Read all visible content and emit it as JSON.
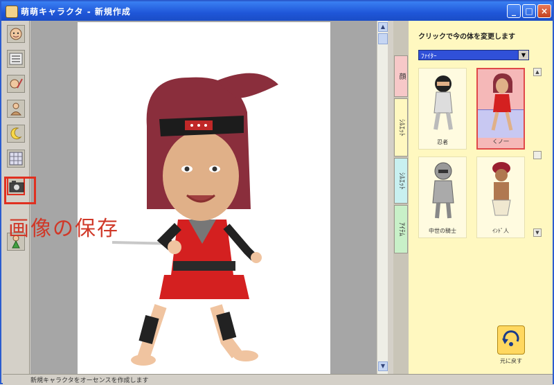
{
  "window": {
    "title": "萌萌キャラクタ - 新規作成",
    "minimize_label": "_",
    "maximize_label": "□",
    "close_label": "×"
  },
  "toolbar": {
    "tools": [
      {
        "icon": "face-icon"
      },
      {
        "icon": "list-icon"
      },
      {
        "icon": "edit-icon"
      },
      {
        "icon": "person-icon"
      },
      {
        "icon": "moon-icon"
      },
      {
        "icon": "grid-icon"
      },
      {
        "icon": "save-image-icon",
        "selected": true
      },
      {
        "icon": "character-icon"
      }
    ]
  },
  "canvas": {
    "overlay_caption": "画像の保存"
  },
  "panel": {
    "tabs": [
      "顔",
      "ｼﾙｴｯﾄ",
      "ｼﾙｴｯﾄ",
      "ｱｲﾃﾑ"
    ],
    "instruction": "クリックで今の体を変更します",
    "category_select": "ﾌｧｲﾀｰ",
    "items": [
      {
        "label": "忍者"
      },
      {
        "label": "くノ一",
        "selected": true
      },
      {
        "label": "中世の騎士"
      },
      {
        "label": "ｲﾝﾄﾞ人"
      }
    ],
    "undo_label": "元に戻す"
  },
  "status": {
    "message": "新規キャラクタをオーセンスを作成します"
  },
  "colors": {
    "titlebar": "#1f56d8",
    "panel_bg": "#fff8c0",
    "accent": "#e03020"
  }
}
